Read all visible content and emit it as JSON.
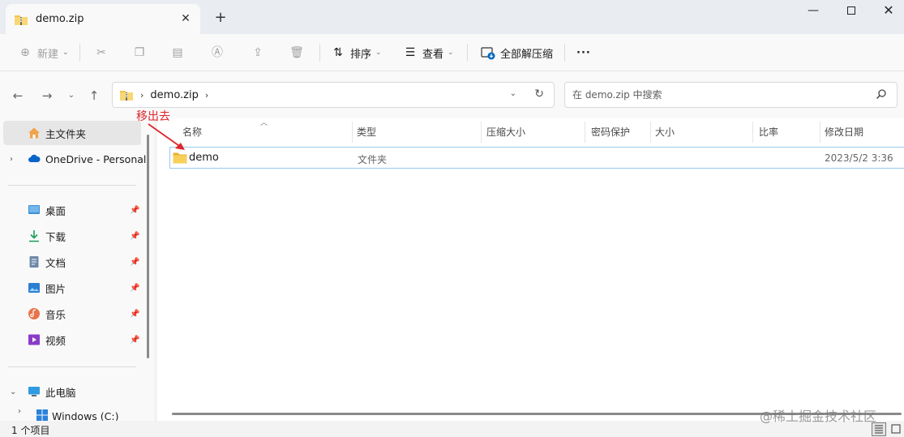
{
  "window": {
    "tab_title": "demo.zip",
    "tab_close": "✕",
    "new_tab": "+",
    "minimize": "—",
    "close": "✕"
  },
  "toolbar": {
    "new_label": "新建",
    "sort_label": "排序",
    "view_label": "查看",
    "extract_all_label": "全部解压缩",
    "more_label": "···"
  },
  "address": {
    "path_segments": [
      "demo.zip"
    ],
    "search_placeholder": "在 demo.zip 中搜索"
  },
  "sidebar": {
    "home": "主文件夹",
    "onedrive": "OneDrive - Personal",
    "quick_access": [
      {
        "label": "桌面"
      },
      {
        "label": "下载"
      },
      {
        "label": "文档"
      },
      {
        "label": "图片"
      },
      {
        "label": "音乐"
      },
      {
        "label": "视频"
      }
    ],
    "this_pc": "此电脑",
    "drive_c": "Windows (C:)"
  },
  "columns": {
    "name": "名称",
    "type": "类型",
    "compressed_size": "压缩大小",
    "password": "密码保护",
    "size": "大小",
    "ratio": "比率",
    "modified": "修改日期"
  },
  "files": [
    {
      "name": "demo",
      "type": "文件夹",
      "modified": "2023/5/2 3:36"
    }
  ],
  "annotation": "移出去",
  "status": {
    "item_count": "1 个项目"
  },
  "watermark": "@稀土掘金技术社区",
  "colors": {
    "accent": "#0067c0",
    "annotation_red": "#e0242a",
    "folder_yellow": "#f4c34d"
  }
}
